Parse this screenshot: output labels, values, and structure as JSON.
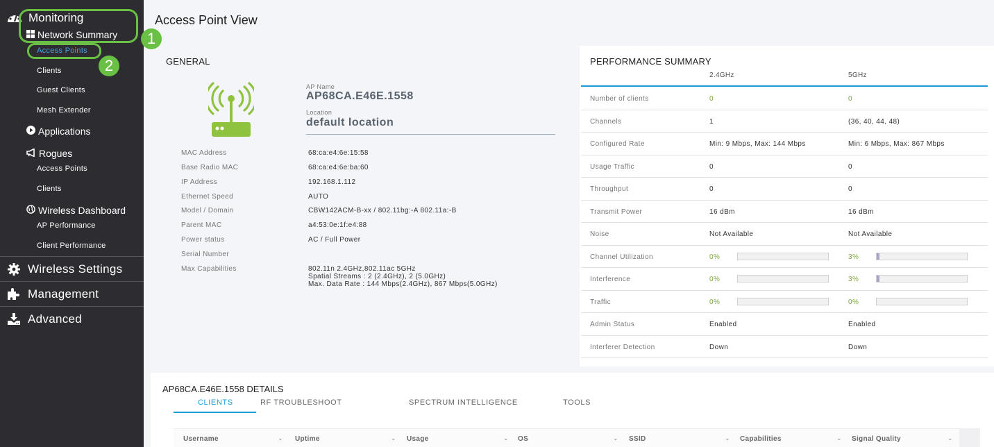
{
  "sidebar": {
    "monitoring": "Monitoring",
    "network_summary": "Network Summary",
    "network_summary_items": [
      "Access Points",
      "Clients",
      "Guest Clients",
      "Mesh Extender"
    ],
    "applications": "Applications",
    "rogues": "Rogues",
    "rogues_items": [
      "Access Points",
      "Clients"
    ],
    "wireless_dashboard": "Wireless Dashboard",
    "wireless_dashboard_items": [
      "AP Performance",
      "Client Performance"
    ],
    "main_items": [
      "Wireless Settings",
      "Management",
      "Advanced"
    ],
    "active_item": "Access Points"
  },
  "callouts": [
    "1",
    "2"
  ],
  "page": {
    "title": "Access Point View"
  },
  "general": {
    "title": "GENERAL",
    "ap_name_label": "AP Name",
    "ap_name": "AP68CA.E46E.1558",
    "location_label": "Location",
    "location": "default location",
    "rows": [
      {
        "key": "MAC Address",
        "value": "68:ca:e4:6e:15:58"
      },
      {
        "key": "Base Radio MAC",
        "value": "68:ca:e4:6e:ba:60"
      },
      {
        "key": "IP Address",
        "value": "192.168.1.112"
      },
      {
        "key": "Ethernet Speed",
        "value": "AUTO"
      },
      {
        "key": "Model / Domain",
        "value": "CBW142ACM-B-xx / 802.11bg:-A 802.11a:-B"
      },
      {
        "key": "Parent MAC",
        "value": "a4:53:0e:1f:e4:88"
      },
      {
        "key": "Power status",
        "value": "AC / Full Power"
      },
      {
        "key": "Serial Number",
        "value": ""
      },
      {
        "key": "Max Capabilities",
        "value_lines": [
          "802.11n 2.4GHz,802.11ac 5GHz",
          "Spatial Streams : 2 (2.4GHz), 2 (5.0GHz)",
          "Max. Data Rate : 144 Mbps(2.4GHz), 867 Mbps(5.0GHz)"
        ]
      }
    ]
  },
  "performance": {
    "title": "PERFORMANCE SUMMARY",
    "columns": [
      "2.4GHz",
      "5GHz"
    ],
    "rows": [
      {
        "key": "Number of clients",
        "v24": "0",
        "v5": "0",
        "green": true
      },
      {
        "key": "Channels",
        "v24": "1",
        "v5": "(36, 40, 44, 48)"
      },
      {
        "key": "Configured Rate",
        "v24": "Min: 9 Mbps, Max: 144 Mbps",
        "v5": "Min: 6 Mbps, Max: 867 Mbps"
      },
      {
        "key": "Usage Traffic",
        "v24": "0",
        "v5": "0"
      },
      {
        "key": "Throughput",
        "v24": "0",
        "v5": "0"
      },
      {
        "key": "Transmit Power",
        "v24": "16 dBm",
        "v5": "16 dBm"
      },
      {
        "key": "Noise",
        "v24": "Not Available",
        "v5": "Not Available"
      },
      {
        "key": "Channel Utilization",
        "v24": "0%",
        "v5": "3%",
        "bar24": 0,
        "bar5": 3,
        "green": true
      },
      {
        "key": "Interference",
        "v24": "0%",
        "v5": "3%",
        "bar24": 0,
        "bar5": 3,
        "green": true
      },
      {
        "key": "Traffic",
        "v24": "0%",
        "v5": "0%",
        "bar24": 0,
        "bar5": 0,
        "green": true
      },
      {
        "key": "Admin Status",
        "v24": "Enabled",
        "v5": "Enabled"
      },
      {
        "key": "Interferer Detection",
        "v24": "Down",
        "v5": "Down"
      }
    ]
  },
  "details": {
    "title": "AP68CA.E46E.1558  DETAILS",
    "tabs": [
      "CLIENTS",
      "RF TROUBLESHOOT",
      "SPECTRUM INTELLIGENCE",
      "TOOLS"
    ],
    "active_tab": "CLIENTS",
    "columns": [
      "Username",
      "Uptime",
      "Usage",
      "OS",
      "SSID",
      "Capabilities",
      "Signal Quality"
    ],
    "sort_icon": "chevron-down-icon"
  },
  "colors": {
    "accent": "#1d9ad6",
    "callout": "#6abf45",
    "ap_icon": "#8fc23f",
    "sidebar_bg": "#2d2c31"
  }
}
